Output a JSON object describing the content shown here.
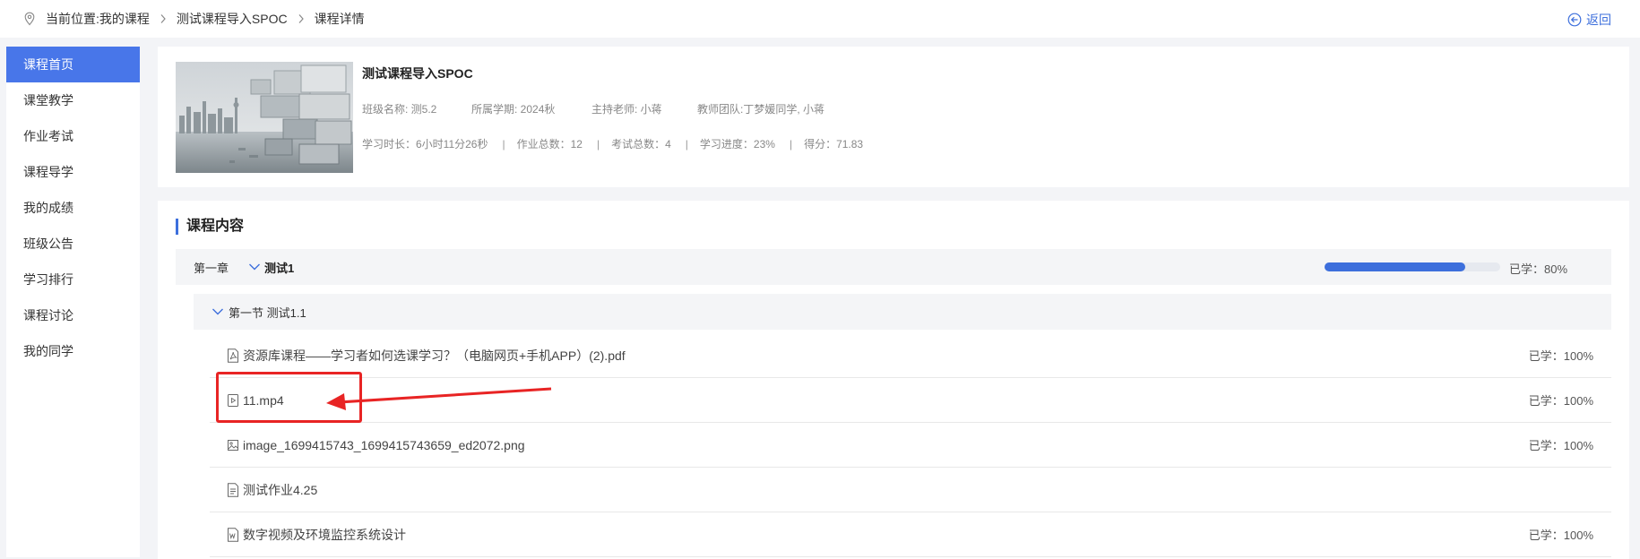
{
  "breadcrumb": {
    "items": [
      "当前位置:我的课程",
      "测试课程导入SPOC",
      "课程详情"
    ]
  },
  "back_label": "返回",
  "sidebar": {
    "items": [
      {
        "label": "课程首页"
      },
      {
        "label": "课堂教学"
      },
      {
        "label": "作业考试"
      },
      {
        "label": "课程导学"
      },
      {
        "label": "我的成绩"
      },
      {
        "label": "班级公告"
      },
      {
        "label": "学习排行"
      },
      {
        "label": "课程讨论"
      },
      {
        "label": "我的同学"
      }
    ],
    "active_index": 0
  },
  "course": {
    "title": "测试课程导入SPOC",
    "class_name": "班级名称: 测5.2",
    "semester": "所属学期: 2024秋",
    "host_teacher": "主持老师: 小蒋",
    "teacher_team": "教师团队:丁梦媛同学, 小蒋",
    "stats": {
      "study_time": "学习时长：6小时11分26秒",
      "homework_total": "作业总数：12",
      "exam_total": "考试总数：4",
      "progress": "学习进度：23%",
      "score": "得分：71.83"
    },
    "stat_separator": "|"
  },
  "content": {
    "title": "课程内容",
    "chapter": {
      "label": "第一章",
      "name": "测试1",
      "progress": 0.8,
      "progress_text": "已学：80%"
    },
    "section": {
      "name": "第一节 测试1.1"
    },
    "resources": [
      {
        "icon": "pdf-icon",
        "name": "资源库课程——学习者如何选课学习？（电脑网页+手机APP）(2).pdf",
        "progress_text": "已学：100%"
      },
      {
        "icon": "video-icon",
        "name": "11.mp4",
        "progress_text": "已学：100%"
      },
      {
        "icon": "image-icon",
        "name": "image_1699415743_1699415743659_ed2072.png",
        "progress_text": "已学：100%"
      },
      {
        "icon": "document-icon",
        "name": "测试作业4.25",
        "progress_text": ""
      },
      {
        "icon": "word-icon",
        "name": "数字视频及环境监控系统设计",
        "progress_text": "已学：100%"
      }
    ]
  },
  "colors": {
    "accent": "#3d6fdc",
    "sidebar_active": "#4876e9",
    "annotation": "#e82424"
  }
}
